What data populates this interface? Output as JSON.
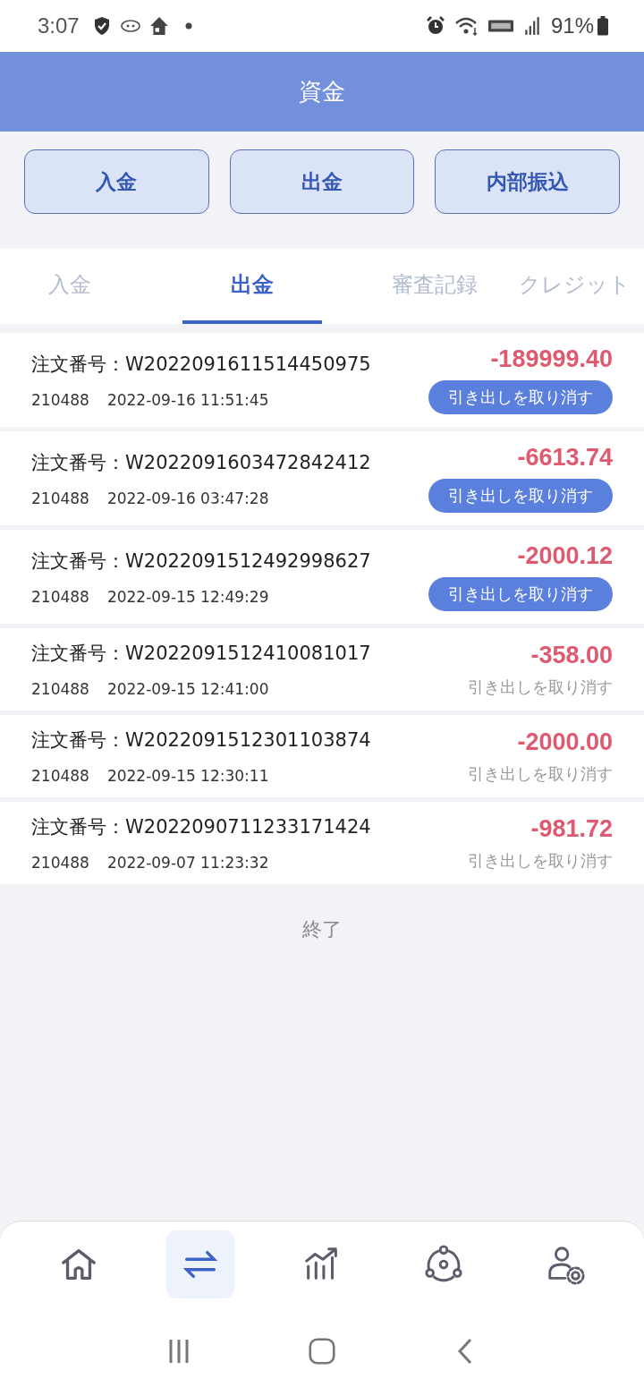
{
  "status_bar": {
    "time": "3:07",
    "battery": "91%"
  },
  "header": {
    "title": "資金"
  },
  "actions": [
    "入金",
    "出金",
    "内部振込"
  ],
  "tabs": [
    {
      "label": "入金",
      "selected": false
    },
    {
      "label": "出金",
      "selected": true
    },
    {
      "label": "審査記録",
      "selected": false
    },
    {
      "label": "クレジット",
      "selected": false
    }
  ],
  "orders": [
    {
      "order_label": "注文番号：",
      "order_no": "W2022091611514450975",
      "user_id": "210488",
      "time": "2022-09-16 11:51:45",
      "amount": "-189999.40",
      "cancel": "引き出しを取り消す",
      "cancellable": true
    },
    {
      "order_label": "注文番号：",
      "order_no": "W2022091603472842412",
      "user_id": "210488",
      "time": "2022-09-16 03:47:28",
      "amount": "-6613.74",
      "cancel": "引き出しを取り消す",
      "cancellable": true
    },
    {
      "order_label": "注文番号：",
      "order_no": "W2022091512492998627",
      "user_id": "210488",
      "time": "2022-09-15 12:49:29",
      "amount": "-2000.12",
      "cancel": "引き出しを取り消す",
      "cancellable": true
    },
    {
      "order_label": "注文番号：",
      "order_no": "W2022091512410081017",
      "user_id": "210488",
      "time": "2022-09-15 12:41:00",
      "amount": "-358.00",
      "cancel": "引き出しを取り消す",
      "cancellable": false
    },
    {
      "order_label": "注文番号：",
      "order_no": "W2022091512301103874",
      "user_id": "210488",
      "time": "2022-09-15 12:30:11",
      "amount": "-2000.00",
      "cancel": "引き出しを取り消す",
      "cancellable": false
    },
    {
      "order_label": "注文番号：",
      "order_no": "W2022090711233171424",
      "user_id": "210488",
      "time": "2022-09-07 11:23:32",
      "amount": "-981.72",
      "cancel": "引き出しを取り消す",
      "cancellable": false
    }
  ],
  "end_text": "終了",
  "nav": [
    {
      "kind": "home",
      "selected": false
    },
    {
      "kind": "transfer",
      "selected": true
    },
    {
      "kind": "chart",
      "selected": false
    },
    {
      "kind": "network",
      "selected": false
    },
    {
      "kind": "account",
      "selected": false
    }
  ]
}
